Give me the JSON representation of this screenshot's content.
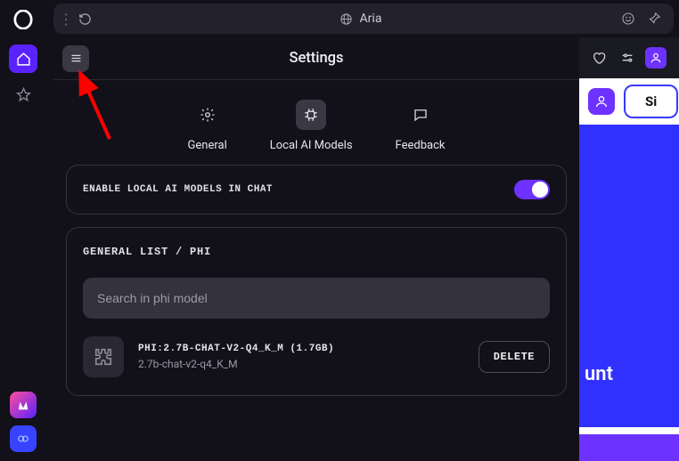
{
  "urlbar": {
    "title": "Aria"
  },
  "panel": {
    "title": "Settings"
  },
  "tabs": {
    "general": "General",
    "local": "Local AI Models",
    "feedback": "Feedback"
  },
  "enable": {
    "label": "ENABLE LOCAL AI MODELS IN CHAT"
  },
  "list": {
    "breadcrumb": "GENERAL LIST / PHI",
    "search_placeholder": "Search in phi model"
  },
  "model": {
    "title": "PHI:2.7B-CHAT-V2-Q4_K_M (1.7GB)",
    "subtitle": "2.7b-chat-v2-q4_K_M",
    "delete": "DELETE"
  },
  "backdrop": {
    "signin": "Si",
    "hero_fragment": "unt"
  }
}
